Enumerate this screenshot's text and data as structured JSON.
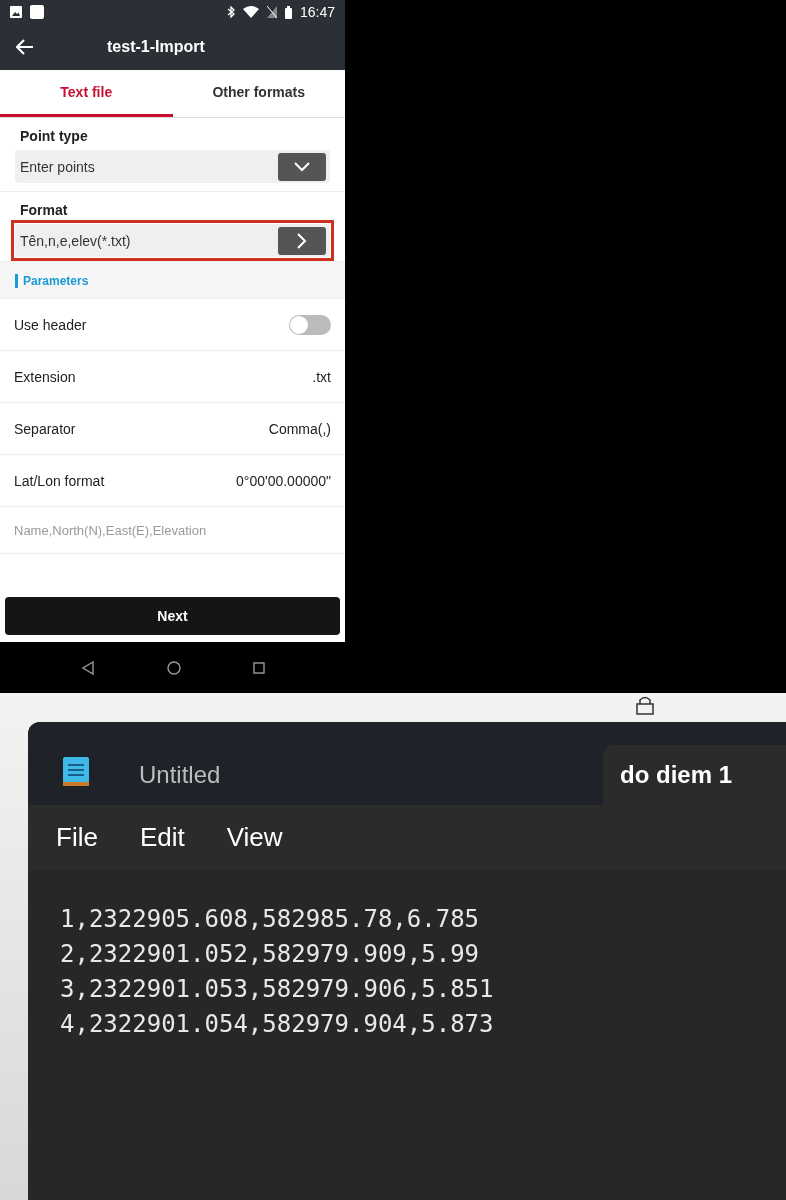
{
  "phone": {
    "status_bar": {
      "time": "16:47"
    },
    "header": {
      "title": "test-1-Import"
    },
    "tabs": [
      {
        "label": "Text file",
        "selected": true
      },
      {
        "label": "Other formats",
        "selected": false
      }
    ],
    "point_type": {
      "label": "Point type",
      "value": "Enter points"
    },
    "format": {
      "label": "Format",
      "value": "Tên,n,e,elev(*.txt)",
      "highlighted": true
    },
    "section_title": "Parameters",
    "params": [
      {
        "kind": "toggle",
        "label": "Use header",
        "on": false
      },
      {
        "kind": "value",
        "label": "Extension",
        "value": ".txt"
      },
      {
        "kind": "value",
        "label": "Separator",
        "value": "Comma(,)"
      },
      {
        "kind": "value",
        "label": "Lat/Lon format",
        "value": "0°00'00.00000\""
      },
      {
        "kind": "hint",
        "label": "Name,North(N),East(E),Elevation"
      }
    ],
    "next_button": "Next"
  },
  "notepad": {
    "tabs": [
      {
        "label": "Untitled",
        "selected": false
      },
      {
        "label": "do diem 1",
        "selected": true
      }
    ],
    "menu": [
      "File",
      "Edit",
      "View"
    ],
    "lines": [
      "1,2322905.608,582985.78,6.785",
      "2,2322901.052,582979.909,5.99",
      "3,2322901.053,582979.906,5.851",
      "4,2322901.054,582979.904,5.873"
    ]
  }
}
